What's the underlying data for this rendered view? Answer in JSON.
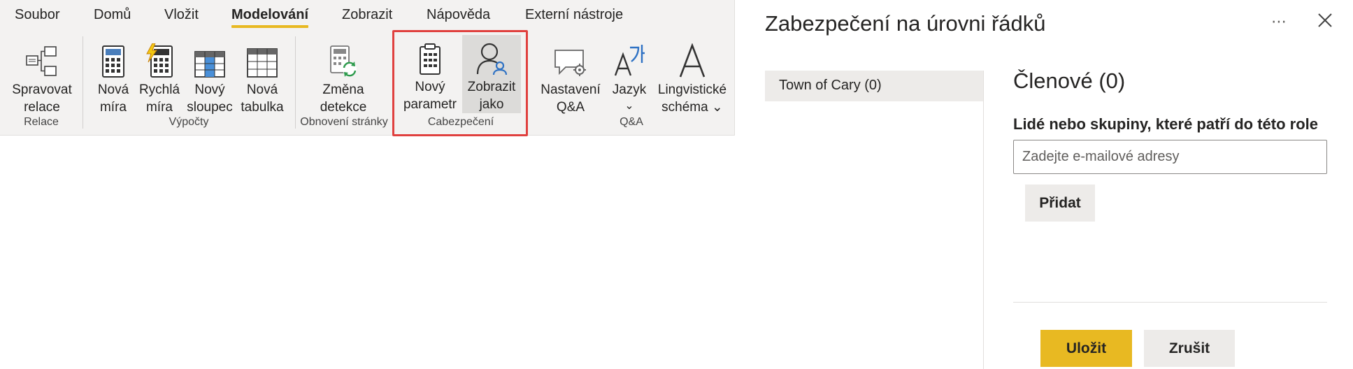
{
  "ribbon": {
    "tabs": [
      {
        "label": "Soubor"
      },
      {
        "label": "Domů"
      },
      {
        "label": "Vložit"
      },
      {
        "label": "Modelování",
        "active": true
      },
      {
        "label": "Zobrazit"
      },
      {
        "label": "Nápověda"
      },
      {
        "label": "Externí nástroje"
      }
    ],
    "buttons": {
      "manage_relations": {
        "line1": "Spravovat",
        "line2": "relace",
        "icon": "manage-relationships-icon"
      },
      "new_measure": {
        "line1": "Nová",
        "line2": "míra",
        "icon": "calculator-icon"
      },
      "quick_measure": {
        "line1": "Rychlá",
        "line2": "míra",
        "icon": "quick-measure-icon"
      },
      "new_column": {
        "line1": "Nový",
        "line2": "sloupec",
        "icon": "new-column-icon"
      },
      "new_table": {
        "line1": "Nová",
        "line2": "tabulka",
        "icon": "new-table-icon"
      },
      "change_detection": {
        "line1": "Změna",
        "line2": "detekce",
        "icon": "change-detection-icon"
      },
      "new_parameter": {
        "line1": "Nový",
        "line2": "parametr",
        "icon": "clipboard-icon"
      },
      "view_as": {
        "line1": "Zobrazit",
        "line2": "jako",
        "icon": "view-as-user-icon"
      },
      "qa_settings": {
        "line1": "Nastavení",
        "line2": "Q&A",
        "icon": "qa-settings-icon"
      },
      "language": {
        "line1": "Jazyk",
        "line2": "⌄",
        "icon": "language-icon"
      },
      "linguistic_schema": {
        "line1": "Lingvistické",
        "line2": "schéma ⌄",
        "icon": "linguistic-schema-icon"
      }
    },
    "groups": {
      "relations": "Relace",
      "calculations": "Výpočty",
      "page_refresh": "Obnovení stránky",
      "security": "Cabezpečení",
      "qa": "Q&A"
    }
  },
  "dialog": {
    "title": "Zabezpečení na úrovni řádků",
    "more_glyph": "⋯",
    "roles": [
      {
        "label": "Town of Cary (0)"
      }
    ],
    "members_title": "Členové (0)",
    "members_description": "Lidé nebo skupiny, které patří do této role",
    "email_placeholder": "Zadejte e-mailové adresy",
    "email_value": "",
    "add_label": "Přidat",
    "save_label": "Uložit",
    "cancel_label": "Zrušit"
  },
  "colors": {
    "accent": "#e8b922",
    "highlight_box": "#e0413f",
    "ribbon_bg": "#f3f2f1"
  }
}
